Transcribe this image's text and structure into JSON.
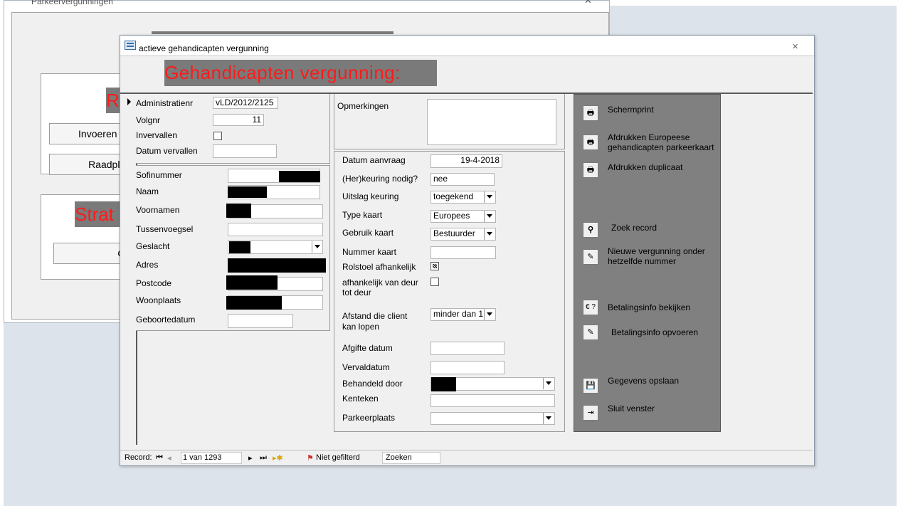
{
  "background_form": {
    "title": "Parkeervergunningen",
    "button1_label": "Invoeren en",
    "button2_label": "Raadpleg",
    "button3_label": "Op",
    "red1": "R",
    "red2": "Strat"
  },
  "window": {
    "title": "actieve gehandicapten vergunning",
    "close": "✕",
    "header_title": "Gehandicapten vergunning:"
  },
  "form": {
    "administratienr_label": "Administratienr",
    "administratienr_value": "vLD/2012/2125",
    "volgnr_label": "Volgnr",
    "volgnr_value": "11",
    "invervallen_label": "Invervallen",
    "datum_vervallen_label": "Datum vervallen",
    "sofinummer_label": "Sofinummer",
    "naam_label": "Naam",
    "voornamen_label": "Voornamen",
    "tussenvoegsel_label": "Tussenvoegsel",
    "geslacht_label": "Geslacht",
    "adres_label": "Adres",
    "postcode_label": "Postcode",
    "woonplaats_label": "Woonplaats",
    "geboortedatum_label": "Geboortedatum",
    "opmerkingen_label": "Opmerkingen",
    "datum_aanvraag_label": "Datum aanvraag",
    "datum_aanvraag_value": "19-4-2018",
    "herkeuring_label": "(Her)keuring nodig?",
    "herkeuring_value": "nee",
    "uitslag_label": "Uitslag keuring",
    "uitslag_value": "toegekend",
    "type_kaart_label": "Type kaart",
    "type_kaart_value": "Europees",
    "gebruik_kaart_label": "Gebruik kaart",
    "gebruik_kaart_value": "Bestuurder",
    "nummer_kaart_label": "Nummer kaart",
    "rolstoel_label": "Rolstoel afhankelijk",
    "deur_label_1": "afhankelijk van deur",
    "deur_label_2": "tot deur",
    "afstand_label_1": "Afstand die client",
    "afstand_label_2": "kan lopen",
    "afstand_value": "minder dan 1",
    "afgifte_label": "Afgifte datum",
    "vervaldatum_label": "Vervaldatum",
    "behandeld_label": "Behandeld door",
    "kenteken_label": "Kenteken",
    "parkeerplaats_label": "Parkeerplaats"
  },
  "actions": {
    "schermprint": "Schermprint",
    "afdrukken_1": "Afdrukken Europeese",
    "afdrukken_2": "gehandicapten parkeerkaart",
    "duplicaat": "Afdrukken duplicaat",
    "zoek": "Zoek record",
    "nieuwe_1": "Nieuwe vergunning onder",
    "nieuwe_2": "hetzelfde nummer",
    "betaling_bekijken_icon": "€ ?",
    "betaling_bekijken": "Betalingsinfo bekijken",
    "betaling_opvoeren": "Betalingsinfo opvoeren",
    "opslaan": "Gegevens opslaan",
    "sluit": "Sluit venster"
  },
  "recordbar": {
    "record_label": "Record:",
    "position": "1 van 1293",
    "filter": "Niet gefilterd",
    "search": "Zoeken"
  }
}
